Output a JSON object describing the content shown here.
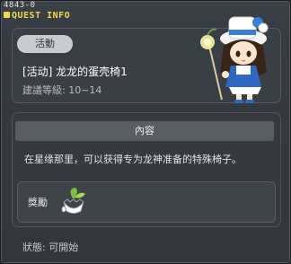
{
  "window": {
    "quest_id": "4843-0",
    "title": "QUEST INFO"
  },
  "quest": {
    "tag": "活動",
    "name": "[活动] 龙龙的蛋壳椅1",
    "level": "建議等級: 10~14"
  },
  "content": {
    "header": "內容",
    "text": "在星缘那里，可以获得专为龙神准备的特殊椅子。"
  },
  "reward": {
    "label": "獎勵",
    "item_icon": "eggshell-chair-icon"
  },
  "status": {
    "text": "狀態: 可開始"
  },
  "npc": {
    "icon": "npc-portrait-icon"
  },
  "colors": {
    "title": "#f1d84a",
    "background": "#363a41"
  }
}
